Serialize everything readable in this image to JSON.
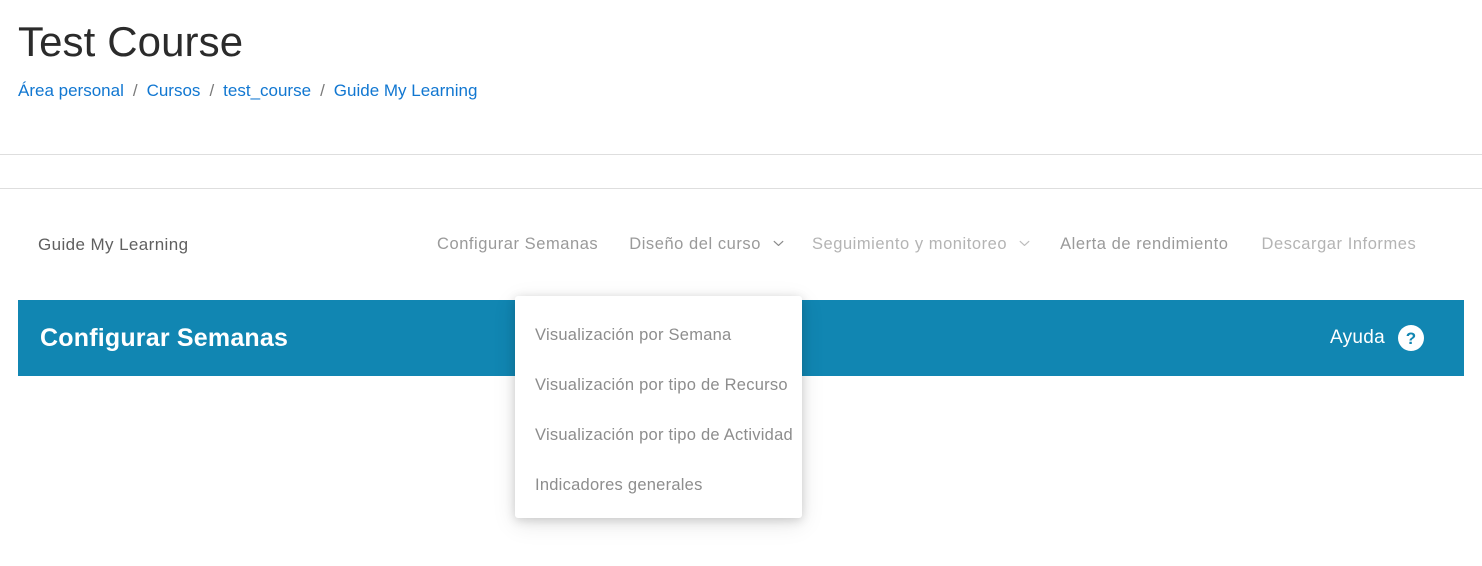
{
  "header": {
    "course_title": "Test Course",
    "breadcrumb": {
      "separator": "/",
      "items": [
        {
          "label": "Área personal"
        },
        {
          "label": "Cursos"
        },
        {
          "label": "test_course"
        },
        {
          "label": "Guide My Learning"
        }
      ]
    }
  },
  "navbar": {
    "brand": "Guide My Learning",
    "items": [
      {
        "label": "Configurar Semanas",
        "has_chevron": false,
        "state": "dim"
      },
      {
        "label": "Diseño del curso",
        "has_chevron": true,
        "state": "dim",
        "chevron_icon": "chevron-down-icon",
        "expanded": true
      },
      {
        "label": "Seguimiento y monitoreo",
        "has_chevron": true,
        "state": "muted",
        "chevron_icon": "chevron-down-icon",
        "expanded": false
      },
      {
        "label": "Alerta de rendimiento",
        "has_chevron": false,
        "state": "dim"
      },
      {
        "label": "Descargar Informes",
        "has_chevron": false,
        "state": "muted"
      }
    ]
  },
  "banner": {
    "title": "Configurar Semanas",
    "help_label": "Ayuda",
    "help_icon": "question-mark-icon",
    "help_icon_glyph": "?",
    "background_color": "#1186b2"
  },
  "dropdown": {
    "open_for": "Diseño del curso",
    "items": [
      {
        "label": "Visualización por Semana"
      },
      {
        "label": "Visualización por tipo de Recurso"
      },
      {
        "label": "Visualización por tipo de Actividad"
      },
      {
        "label": "Indicadores generales"
      }
    ]
  },
  "colors": {
    "accent": "#1186b2",
    "link": "#1177d1",
    "nav_text": "#8f8f8f",
    "divider": "#dedede"
  }
}
